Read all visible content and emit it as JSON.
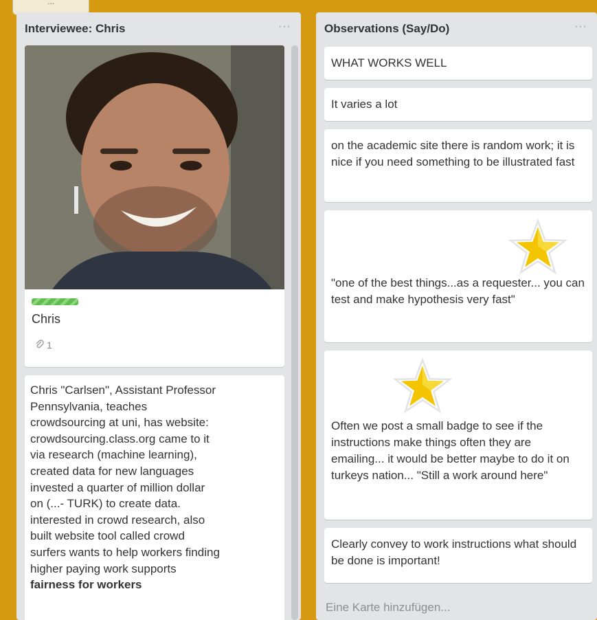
{
  "top_tag": "...",
  "lists": [
    {
      "title": "Interviewee: Chris",
      "menu_label": "···",
      "cards": {
        "photo_card": {
          "title": "Chris",
          "attachment_count": "1"
        },
        "bio_card": {
          "lines": [
            "Chris \"Carlsen\", Assistant Professor",
            "Pennsylvania, teaches",
            "crowdsourcing at uni, has website:",
            "crowdsourcing.class.org came to it",
            "via research (machine learning),",
            "created data for new languages",
            "invested a quarter of million dollar",
            "on (...- TURK) to create data.",
            "interested in crowd research, also",
            "built website tool called crowd",
            "surfers wants to help workers finding",
            "higher paying work supports",
            "fairness for workers"
          ]
        }
      }
    },
    {
      "title": "Observations (Say/Do)",
      "menu_label": "···",
      "cards": [
        {
          "text": "WHAT WORKS WELL"
        },
        {
          "text": "It varies a lot"
        },
        {
          "text": "on the academic site there is random work; it is nice if you need something to be illustrated fast"
        },
        {
          "text": "\"one of the best things...as a requester... you can test and make hypothesis very fast\""
        },
        {
          "text": "Often we post a small badge to see if the instructions make things often they are emailing... it would be better maybe to do it on turkeys nation... \"Still a work around here\""
        },
        {
          "text": "Clearly convey to work instructions what should be done is important!"
        }
      ],
      "add_card_label": "Eine Karte hinzufügen..."
    }
  ],
  "colors": {
    "board_bg": "#d59a12",
    "list_bg": "#e2e4e6",
    "card_bg": "#ffffff",
    "label_green": "#61bd4f",
    "star_yellow": "#f2c500"
  },
  "icons": {
    "attachment": "paperclip-icon",
    "star": "star-sticker-icon"
  }
}
